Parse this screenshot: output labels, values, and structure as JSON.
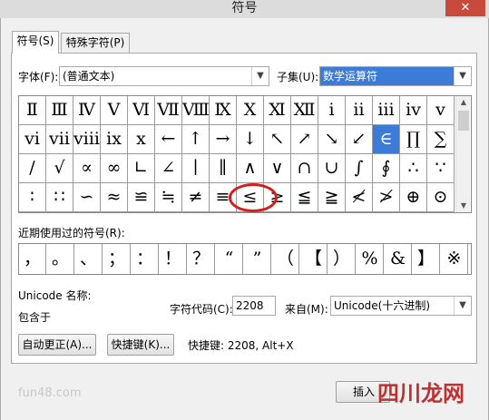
{
  "window": {
    "title": "符号",
    "close_glyph": "✕"
  },
  "tabs": [
    {
      "label": "符号(S)"
    },
    {
      "label": "特殊字符(P)"
    }
  ],
  "font": {
    "label": "字体(F):",
    "value": "(普通文本)"
  },
  "subset": {
    "label": "子集(U):",
    "value": "数学运算符"
  },
  "symbols": [
    [
      "Ⅱ",
      "Ⅲ",
      "Ⅳ",
      "Ⅴ",
      "Ⅵ",
      "Ⅶ",
      "Ⅷ",
      "Ⅸ",
      "Ⅹ",
      "Ⅺ",
      "Ⅻ",
      "ⅰ",
      "ⅱ",
      "ⅲ",
      "ⅳ",
      "ⅴ"
    ],
    [
      "ⅵ",
      "ⅶ",
      "ⅷ",
      "ⅸ",
      "ⅹ",
      "←",
      "↑",
      "→",
      "↓",
      "↖",
      "↗",
      "↘",
      "↙",
      "∈",
      "∏",
      "∑"
    ],
    [
      "∕",
      "√",
      "∝",
      "∞",
      "∟",
      "∠",
      "∣",
      "∥",
      "∧",
      "∨",
      "∩",
      "∪",
      "∫",
      "∮",
      "∴",
      "∵"
    ],
    [
      "∶",
      "∷",
      "∽",
      "≈",
      "≌",
      "≒",
      "≠",
      "≡",
      "≤",
      "≥",
      "≦",
      "≧",
      "≮",
      "≯",
      "⊕",
      "⊙"
    ]
  ],
  "selected_symbol": "∈",
  "recent": {
    "label": "近期使用过的符号(R):",
    "items": [
      "，",
      "。",
      "、",
      "；",
      "：",
      "！",
      "？",
      "“",
      "”",
      "（",
      "【",
      "）",
      "%",
      "&",
      "】",
      "※"
    ]
  },
  "unicode_name_label": "Unicode 名称:",
  "contained_label": "包含于",
  "char_code": {
    "label": "字符代码(C):",
    "value": "2208"
  },
  "from": {
    "label": "来自(M):",
    "value": "Unicode(十六进制)"
  },
  "buttons": {
    "autocorrect": "自动更正(A)...",
    "shortcut": "快捷键(K)...",
    "insert": "插入"
  },
  "shortcut_text": "快捷键: 2208, Alt+X",
  "watermark": "fun48.com",
  "logo": "四川龙网"
}
